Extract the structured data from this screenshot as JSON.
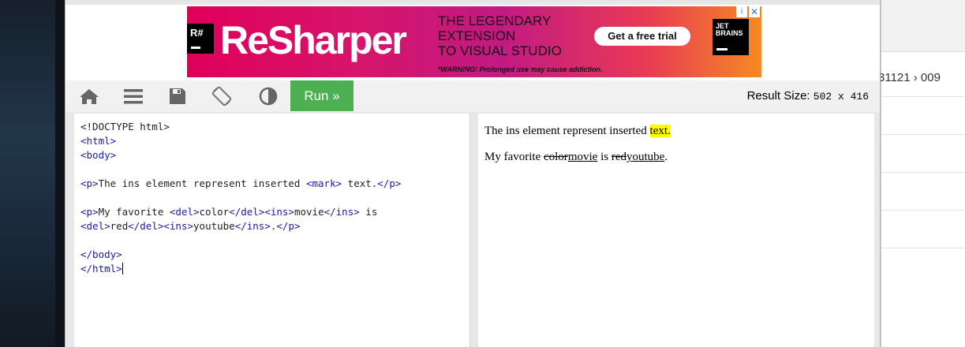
{
  "ad": {
    "brand_badge": "R#",
    "brand": "ReSharper",
    "headline_1": "THE LEGENDARY",
    "headline_2": "EXTENSION",
    "headline_3": "TO VISUAL STUDIO",
    "cta": "Get a free trial",
    "warning": "*WARNING! Prolonged use may cause addiction.",
    "vendor_1": "JET",
    "vendor_2": "BRAINS",
    "colors": {
      "start": "#e0005a",
      "end": "#f58a22"
    }
  },
  "toolbar": {
    "icons": [
      "home-icon",
      "menu-icon",
      "save-icon",
      "rotate-icon",
      "contrast-icon"
    ],
    "run_label": "Run »",
    "result_size_label": "Result Size:",
    "result_size_value": "502 x 416",
    "run_color": "#4caf50"
  },
  "code": {
    "lines": [
      "<!DOCTYPE html>",
      "<html>",
      "<body>",
      "",
      "<p>The ins element represent inserted <mark> text.</p>",
      "",
      "<p>My favorite <del>color</del><ins>movie</ins> is",
      "<del>red</del><ins>youtube</ins>.</p>",
      "",
      "</body>",
      "</html>"
    ]
  },
  "result": {
    "p1_text": "The ins element represent inserted ",
    "p1_mark": "text.",
    "p2_a": "My favorite ",
    "p2_del1": "color",
    "p2_ins1": "movie",
    "p2_b": " is ",
    "p2_del2": "red",
    "p2_ins2": "youtube",
    "p2_c": "."
  },
  "bg_window": {
    "breadcrumb": "31121 › 009"
  }
}
